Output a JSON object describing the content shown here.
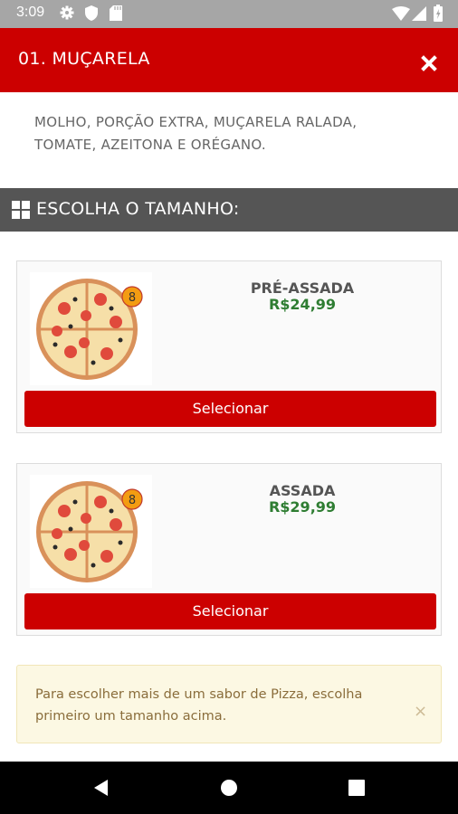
{
  "status_bar": {
    "time": "3:09"
  },
  "header": {
    "title": "01. MUÇARELA"
  },
  "description": "MOLHO, PORÇÃO EXTRA, MUÇARELA RALADA, TOMATE, AZEITONA E ORÉGANO.",
  "section": {
    "label": "ESCOLHA O TAMANHO:"
  },
  "options": [
    {
      "name": "PRÉ-ASSADA",
      "price": "R$24,99",
      "slices": "8",
      "button": "Selecionar"
    },
    {
      "name": "ASSADA",
      "price": "R$29,99",
      "slices": "8",
      "button": "Selecionar"
    }
  ],
  "alert": {
    "text": "Para escolher mais de um sabor de Pizza, escolha primeiro um tamanho acima.",
    "close": "×"
  },
  "colors": {
    "brand_red": "#cc0000",
    "price_green": "#2e7d32",
    "section_gray": "#555555",
    "alert_bg": "#fcf8e3"
  },
  "icons": [
    "gear-icon",
    "shield-icon",
    "sd-card-icon",
    "wifi-icon",
    "signal-icon",
    "battery-icon",
    "close-icon",
    "grid-icon",
    "back-icon",
    "home-icon",
    "recents-icon"
  ]
}
